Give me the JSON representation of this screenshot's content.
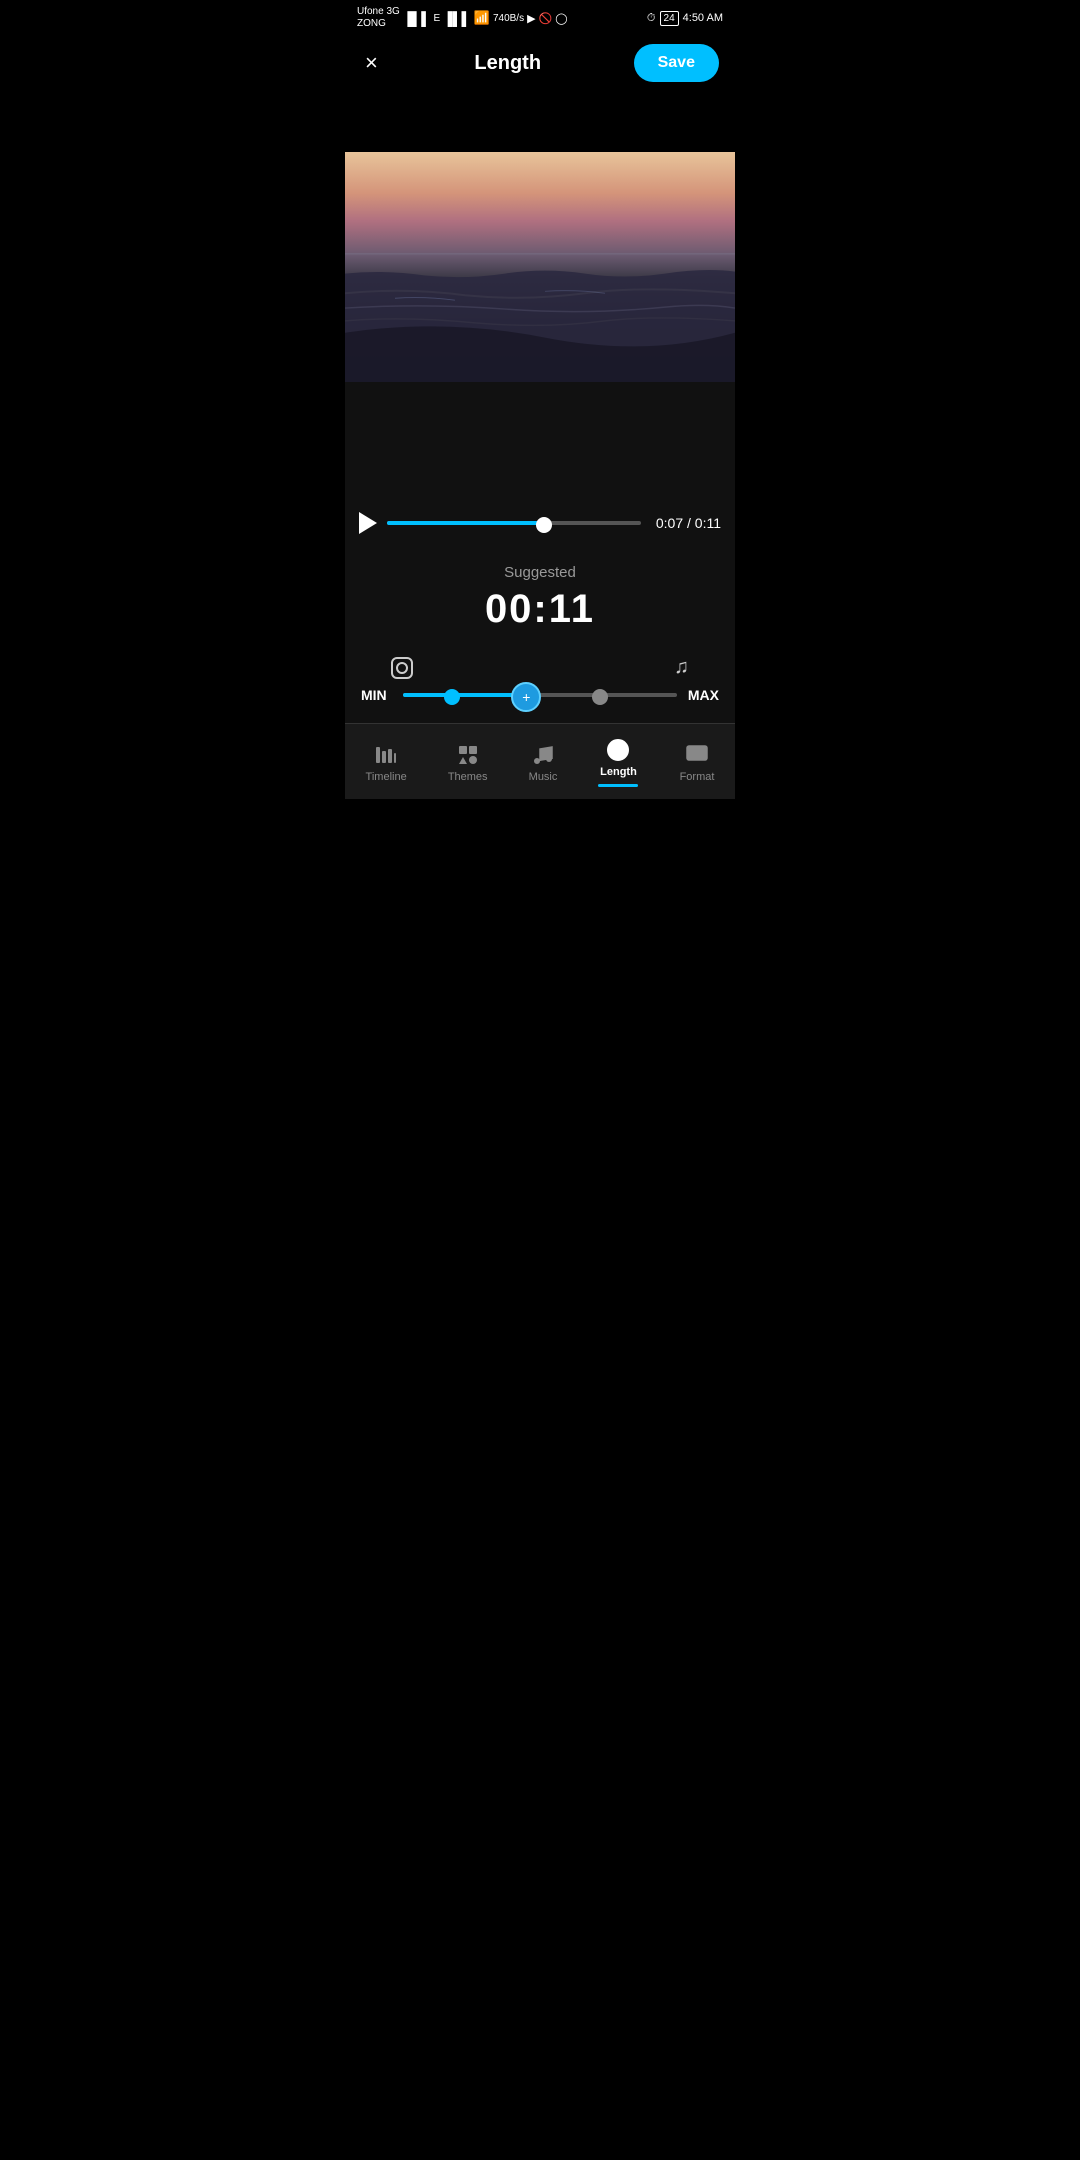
{
  "statusBar": {
    "carrier": "Ufone 3G",
    "carrier2": "ZONG",
    "network": "E",
    "signal": "|||",
    "wifi": "WiFi",
    "speed": "740B/s",
    "time": "4:50 AM",
    "battery": "24"
  },
  "header": {
    "title": "Length",
    "saveLabel": "Save",
    "closeIcon": "×"
  },
  "playback": {
    "currentTime": "0:07",
    "totalTime": "0:11",
    "timeDisplay": "0:07 / 0:11",
    "progressPercent": 62
  },
  "suggested": {
    "label": "Suggested",
    "time": "00:11"
  },
  "slider": {
    "minLabel": "MIN",
    "maxLabel": "MAX"
  },
  "bottomNav": {
    "items": [
      {
        "id": "timeline",
        "label": "Timeline",
        "active": false
      },
      {
        "id": "themes",
        "label": "Themes",
        "active": false
      },
      {
        "id": "music",
        "label": "Music",
        "active": false
      },
      {
        "id": "length",
        "label": "Length",
        "active": true
      },
      {
        "id": "format",
        "label": "Format",
        "active": false
      }
    ]
  }
}
